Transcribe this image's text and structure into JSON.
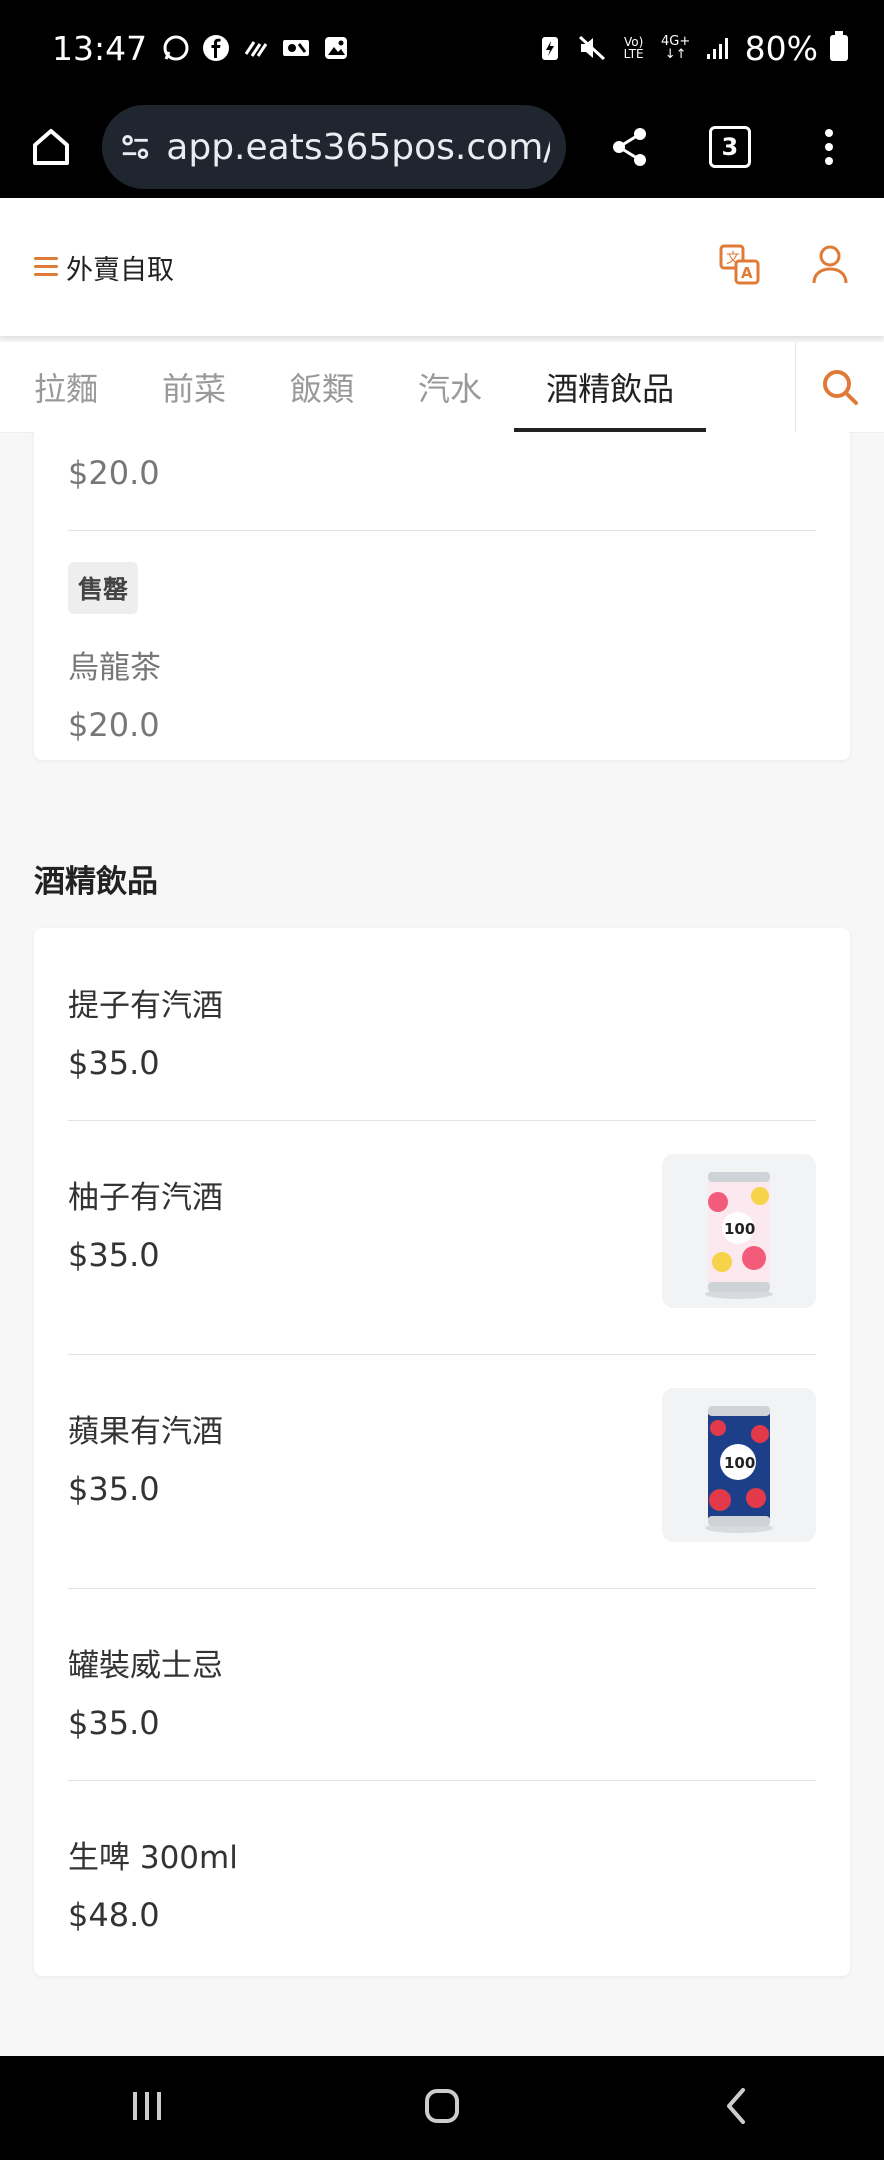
{
  "status_bar": {
    "time": "13:47",
    "battery": "80%"
  },
  "browser": {
    "url": "app.eats365pos.com/l",
    "tab_count": "3"
  },
  "header": {
    "title": "外賣自取"
  },
  "categories": [
    "拉麵",
    "前菜",
    "飯類",
    "汽水",
    "酒精飲品"
  ],
  "active_category": "酒精飲品",
  "previous_section": {
    "partial_item_price": "$20.0",
    "items": [
      {
        "badge": "售罄",
        "name": "烏龍茶",
        "price": "$20.0"
      }
    ]
  },
  "alcohol_section": {
    "title": "酒精飲品",
    "items": [
      {
        "name": "提子有汽酒",
        "price": "$35.0",
        "image": "none"
      },
      {
        "name": "柚子有汽酒",
        "price": "$35.0",
        "image": "can-pink-yellow"
      },
      {
        "name": "蘋果有汽酒",
        "price": "$35.0",
        "image": "can-navy-red"
      },
      {
        "name": "罐裝威士忌",
        "price": "$35.0",
        "image": "none"
      },
      {
        "name": "生啤 300ml",
        "price": "$48.0",
        "image": "none"
      }
    ]
  },
  "colors": {
    "accent": "#e07a37",
    "active_tab_underline": "#222222"
  }
}
